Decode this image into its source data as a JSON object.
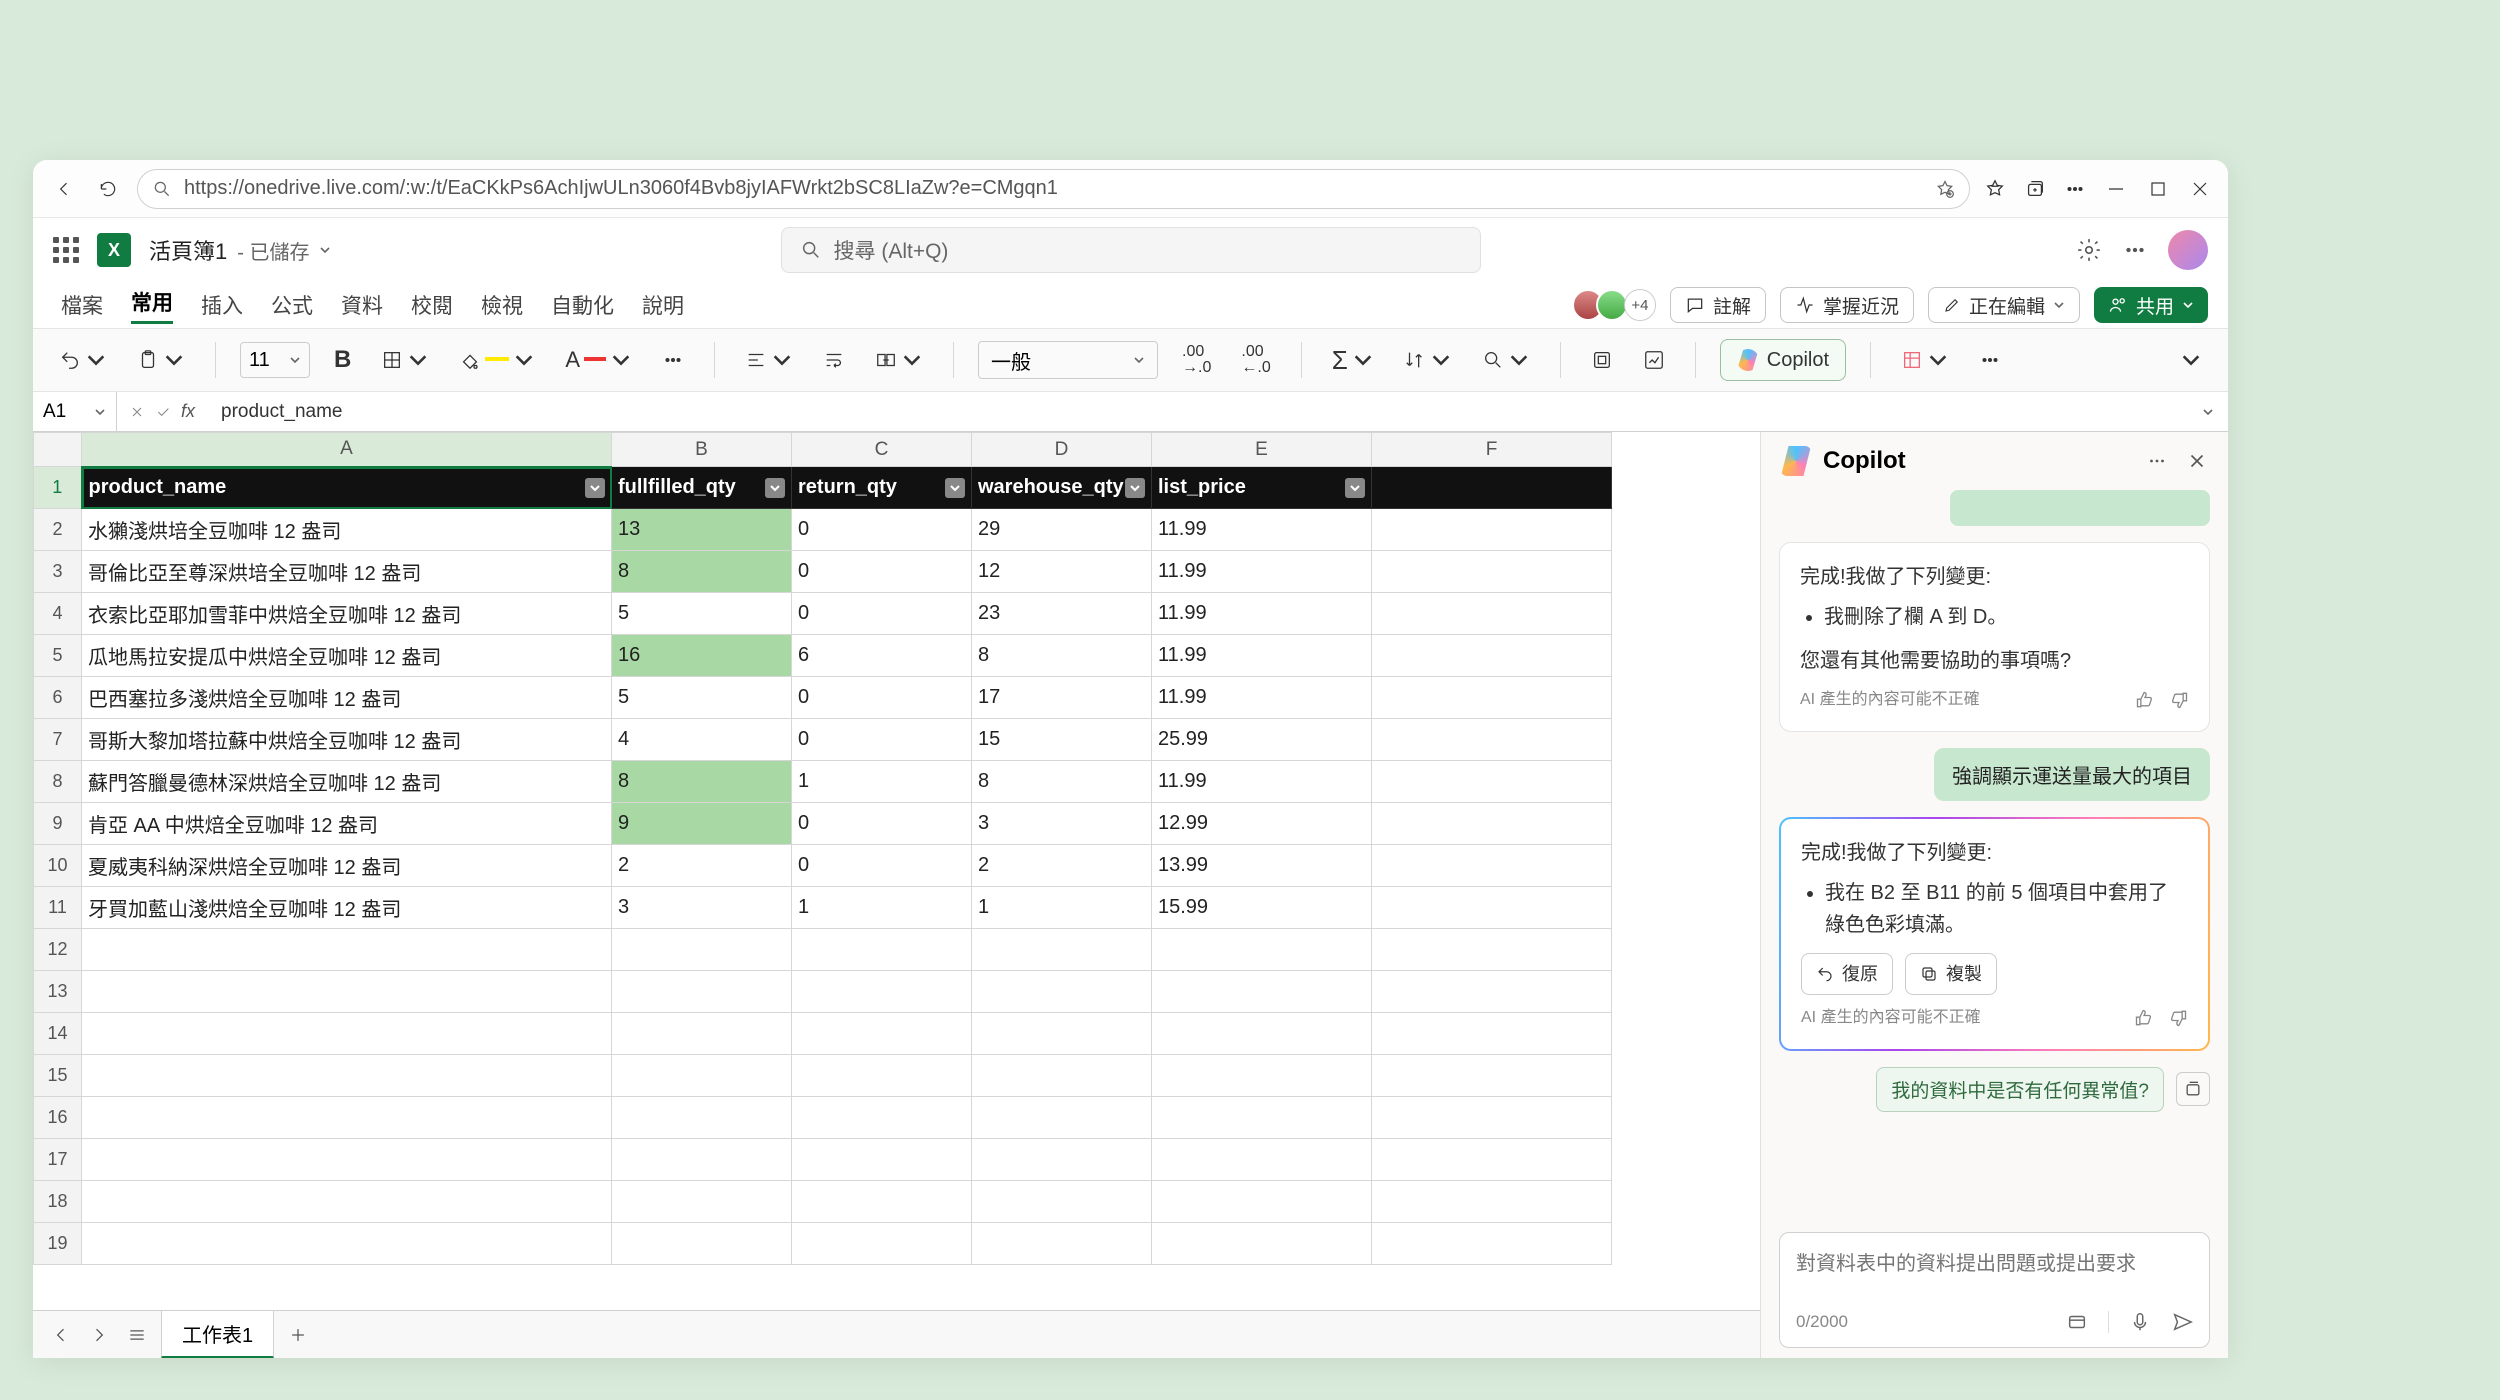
{
  "browser": {
    "url": "https://onedrive.live.com/:w:/t/EaCKkPs6AchIjwULn3060f4Bvb8jyIAFWrkt2bSC8LIaZw?e=CMgqn1"
  },
  "app": {
    "doc_name": "活頁簿1",
    "saved_status": "已儲存",
    "search_placeholder": "搜尋 (Alt+Q)"
  },
  "ribbon": {
    "tabs": [
      "檔案",
      "常用",
      "插入",
      "公式",
      "資料",
      "校閱",
      "檢視",
      "自動化",
      "說明"
    ],
    "active_index": 1,
    "presence_more": "+4",
    "comments": "註解",
    "catchup": "掌握近況",
    "editing": "正在編輯",
    "share": "共用"
  },
  "toolbar": {
    "font_size": "11",
    "style": "一般",
    "copilot": "Copilot"
  },
  "formula": {
    "name_box": "A1",
    "value": "product_name"
  },
  "sheet": {
    "columns_letters": [
      "A",
      "B",
      "C",
      "D",
      "E",
      "F"
    ],
    "headers": [
      "product_name",
      "fullfilled_qty",
      "return_qty",
      "warehouse_qty",
      "list_price"
    ],
    "rows": [
      {
        "a": "水獺淺烘培全豆咖啡 12 盎司",
        "b": "13",
        "c": "0",
        "d": "29",
        "e": "11.99",
        "hl": true
      },
      {
        "a": "哥倫比亞至尊深烘培全豆咖啡 12 盎司",
        "b": "8",
        "c": "0",
        "d": "12",
        "e": "11.99",
        "hl": true
      },
      {
        "a": "衣索比亞耶加雪菲中烘焙全豆咖啡 12 盎司",
        "b": "5",
        "c": "0",
        "d": "23",
        "e": "11.99",
        "hl": false
      },
      {
        "a": "瓜地馬拉安提瓜中烘焙全豆咖啡 12 盎司",
        "b": "16",
        "c": "6",
        "d": "8",
        "e": "11.99",
        "hl": true
      },
      {
        "a": "巴西塞拉多淺烘焙全豆咖啡 12 盎司",
        "b": "5",
        "c": "0",
        "d": "17",
        "e": "11.99",
        "hl": false
      },
      {
        "a": "哥斯大黎加塔拉蘇中烘焙全豆咖啡 12 盎司",
        "b": "4",
        "c": "0",
        "d": "15",
        "e": "25.99",
        "hl": false
      },
      {
        "a": "蘇門答臘曼德林深烘焙全豆咖啡 12 盎司",
        "b": "8",
        "c": "1",
        "d": "8",
        "e": "11.99",
        "hl": true
      },
      {
        "a": "肯亞 AA 中烘焙全豆咖啡 12 盎司",
        "b": "9",
        "c": "0",
        "d": "3",
        "e": "12.99",
        "hl": true
      },
      {
        "a": "夏威夷科納深烘焙全豆咖啡 12 盎司",
        "b": "2",
        "c": "0",
        "d": "2",
        "e": "13.99",
        "hl": false
      },
      {
        "a": "牙買加藍山淺烘焙全豆咖啡 12 盎司",
        "b": "3",
        "c": "1",
        "d": "1",
        "e": "15.99",
        "hl": false
      }
    ],
    "empty_rows": 8,
    "tab_name": "工作表1"
  },
  "copilot": {
    "title": "Copilot",
    "msg1": {
      "intro": "完成!我做了下列變更:",
      "bullet": "我刪除了欄 A 到 D。",
      "followup": "您還有其他需要協助的事項嗎?",
      "disclaimer": "AI 產生的內容可能不正確"
    },
    "user_msg": "強調顯示運送量最大的項目",
    "msg2": {
      "intro": "完成!我做了下列變更:",
      "bullet": "我在 B2 至 B11 的前 5 個項目中套用了綠色色彩填滿。",
      "undo": "復原",
      "copy": "複製",
      "disclaimer": "AI 產生的內容可能不正確"
    },
    "suggest": "我的資料中是否有任何異常值?",
    "input_placeholder": "對資料表中的資料提出問題或提出要求",
    "char_count": "0/2000"
  }
}
